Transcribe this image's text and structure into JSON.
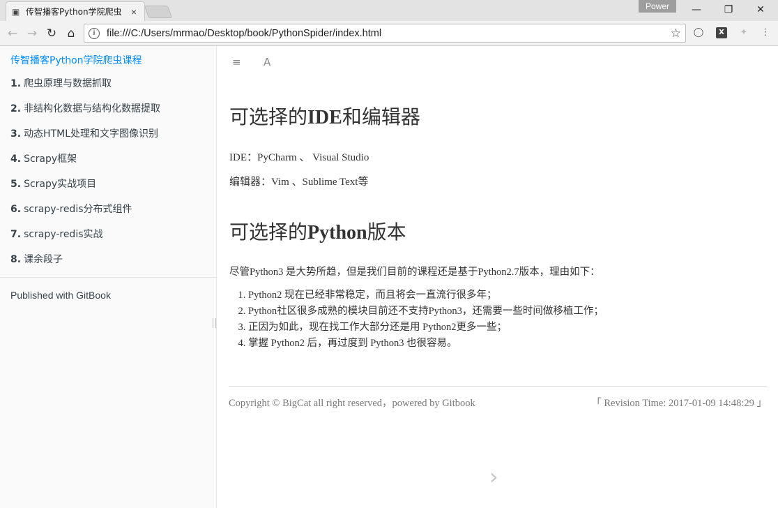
{
  "browser": {
    "tab_title": "传智播客Python学院爬虫",
    "tab_close": "×",
    "power_badge": "Power",
    "url": "file:///C:/Users/mrmao/Desktop/book/PythonSpider/index.html",
    "win_minimize": "—",
    "win_restore": "❐",
    "win_close": "✕"
  },
  "sidebar": {
    "book_title": "传智播客Python学院爬虫课程",
    "items": [
      {
        "num": "1.",
        "label": "爬虫原理与数据抓取"
      },
      {
        "num": "2.",
        "label": "非结构化数据与结构化数据提取"
      },
      {
        "num": "3.",
        "label": "动态HTML处理和文字图像识别"
      },
      {
        "num": "4.",
        "label": "Scrapy框架"
      },
      {
        "num": "5.",
        "label": "Scrapy实战项目"
      },
      {
        "num": "6.",
        "label": "scrapy-redis分布式组件"
      },
      {
        "num": "7.",
        "label": "scrapy-redis实战"
      },
      {
        "num": "8.",
        "label": "课余段子"
      }
    ],
    "published": "Published with GitBook"
  },
  "article": {
    "h1_ide_pre": "可选择的",
    "h1_ide_bold": "IDE",
    "h1_ide_post": "和编辑器",
    "ide_line": "IDE：PyCharm 、 Visual Studio",
    "editor_line": "编辑器：Vim 、Sublime Text等",
    "h1_py_pre": "可选择的",
    "h1_py_bold": "Python",
    "h1_py_post": "版本",
    "intro": "尽管Python3 是大势所趋，但是我们目前的课程还是基于Python2.7版本，理由如下：",
    "reasons": [
      "Python2 现在已经非常稳定，而且将会一直流行很多年；",
      "Python社区很多成熟的模块目前还不支持Python3，还需要一些时间做移植工作；",
      "正因为如此，现在找工作大部分还是用 Python2更多一些；",
      "掌握 Python2 后，再过度到 Python3 也很容易。"
    ]
  },
  "footer": {
    "copyright": "Copyright © BigCat all right reserved，powered by Gitbook",
    "revision": "「 Revision Time: 2017-01-09 14:48:29 」"
  }
}
